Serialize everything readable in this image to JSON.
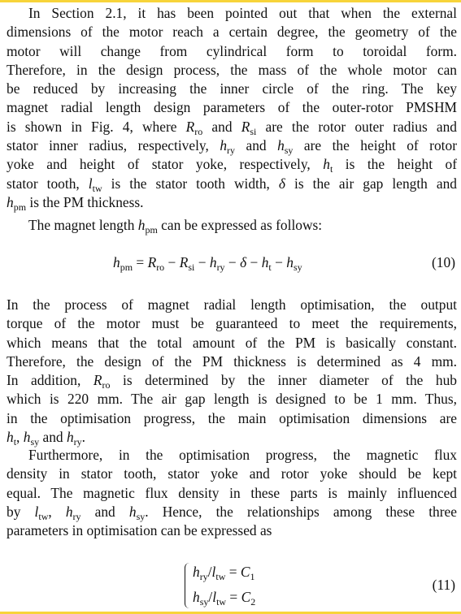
{
  "paragraphs": [
    {
      "indent": true,
      "lines": [
        [
          {
            "t": "In Section 2.1, it has been pointed out that when the external"
          }
        ],
        [
          {
            "t": "dimensions of the motor reach a certain degree, the geometry of the"
          }
        ],
        [
          {
            "t": "motor will change from cylindrical form to toroidal form."
          }
        ],
        [
          {
            "t": "Therefore, in the design process, the mass of the whole motor can"
          }
        ],
        [
          {
            "t": "be reduced by increasing the inner circle of the ring. The key"
          }
        ],
        [
          {
            "t": "magnet radial length design parameters of the outer-rotor PMSHM"
          }
        ],
        [
          {
            "t": "is shown in Fig. 4, where "
          },
          {
            "v": "R",
            "s": "ro"
          },
          {
            "t": " and "
          },
          {
            "v": "R",
            "s": "si"
          },
          {
            "t": " are the rotor outer radius and"
          }
        ],
        [
          {
            "t": "stator inner radius, respectively, "
          },
          {
            "v": "h",
            "s": "ry"
          },
          {
            "t": " and "
          },
          {
            "v": "h",
            "s": "sy"
          },
          {
            "t": " are the height of rotor"
          }
        ],
        [
          {
            "t": "yoke and height of stator yoke, respectively, "
          },
          {
            "v": "h",
            "s": "t"
          },
          {
            "t": " is the height of"
          }
        ],
        [
          {
            "t": "stator tooth, "
          },
          {
            "v": "l",
            "s": "tw"
          },
          {
            "t": " is the stator tooth width, "
          },
          {
            "v": "δ"
          },
          {
            "t": " is the air gap length and"
          }
        ],
        [
          {
            "v": "h",
            "s": "pm"
          },
          {
            "t": " is the PM thickness."
          }
        ]
      ]
    },
    {
      "indent": true,
      "lines": [
        [
          {
            "t": "The magnet length "
          },
          {
            "v": "h",
            "s": "pm"
          },
          {
            "t": " can be expressed as follows:"
          }
        ]
      ]
    },
    {
      "indent": false,
      "lines": [
        [
          {
            "t": "In the process of magnet radial length optimisation, the output"
          }
        ],
        [
          {
            "t": "torque of the motor must be guaranteed to meet the requirements,"
          }
        ],
        [
          {
            "t": "which means that the total amount of the PM is basically constant."
          }
        ],
        [
          {
            "t": "Therefore, the design of the PM thickness is determined as 4 mm."
          }
        ],
        [
          {
            "t": "In addition, "
          },
          {
            "v": "R",
            "s": "ro"
          },
          {
            "t": " is determined by the inner diameter of the hub"
          }
        ],
        [
          {
            "t": "which is 220 mm. The air gap length is designed to be 1 mm. Thus,"
          }
        ],
        [
          {
            "t": "in the optimisation progress, the main optimisation dimensions are"
          }
        ],
        [
          {
            "v": "h",
            "s": "t"
          },
          {
            "t": ", "
          },
          {
            "v": "h",
            "s": "sy"
          },
          {
            "t": " and "
          },
          {
            "v": "h",
            "s": "ry"
          },
          {
            "t": "."
          }
        ]
      ]
    },
    {
      "indent": true,
      "lines": [
        [
          {
            "t": "Furthermore, in the optimisation progress, the magnetic flux"
          }
        ],
        [
          {
            "t": "density in stator tooth, stator yoke and rotor yoke should be kept"
          }
        ],
        [
          {
            "t": "equal. The magnetic flux density in these parts is mainly influenced"
          }
        ],
        [
          {
            "t": "by "
          },
          {
            "v": "l",
            "s": "tw"
          },
          {
            "t": ", "
          },
          {
            "v": "h",
            "s": "ry"
          },
          {
            "t": " and "
          },
          {
            "v": "h",
            "s": "sy"
          },
          {
            "t": ". Hence, the relationships among these three"
          }
        ],
        [
          {
            "t": "parameters in optimisation can be expressed as"
          }
        ]
      ]
    }
  ],
  "equations": {
    "eq10": {
      "segments": [
        {
          "v": "h",
          "s": "pm"
        },
        {
          "t": " = "
        },
        {
          "v": "R",
          "s": "ro"
        },
        {
          "t": " − "
        },
        {
          "v": "R",
          "s": "si"
        },
        {
          "t": " − "
        },
        {
          "v": "h",
          "s": "ry"
        },
        {
          "t": " − "
        },
        {
          "v": "δ"
        },
        {
          "t": " − "
        },
        {
          "v": "h",
          "s": "t"
        },
        {
          "t": " − "
        },
        {
          "v": "h",
          "s": "sy"
        }
      ],
      "number": "(10)"
    },
    "eq11a": {
      "segments": [
        {
          "v": "h",
          "s": "ry"
        },
        {
          "t": "/"
        },
        {
          "v": "l",
          "s": "tw"
        },
        {
          "t": " = "
        },
        {
          "v": "C",
          "s": "1"
        }
      ]
    },
    "eq11b": {
      "segments": [
        {
          "v": "h",
          "s": "sy"
        },
        {
          "t": "/"
        },
        {
          "v": "l",
          "s": "tw"
        },
        {
          "t": " = "
        },
        {
          "v": "C",
          "s": "2"
        }
      ]
    },
    "eq11_number": "(11)"
  },
  "colors": {
    "edge": "#f7d43a"
  }
}
